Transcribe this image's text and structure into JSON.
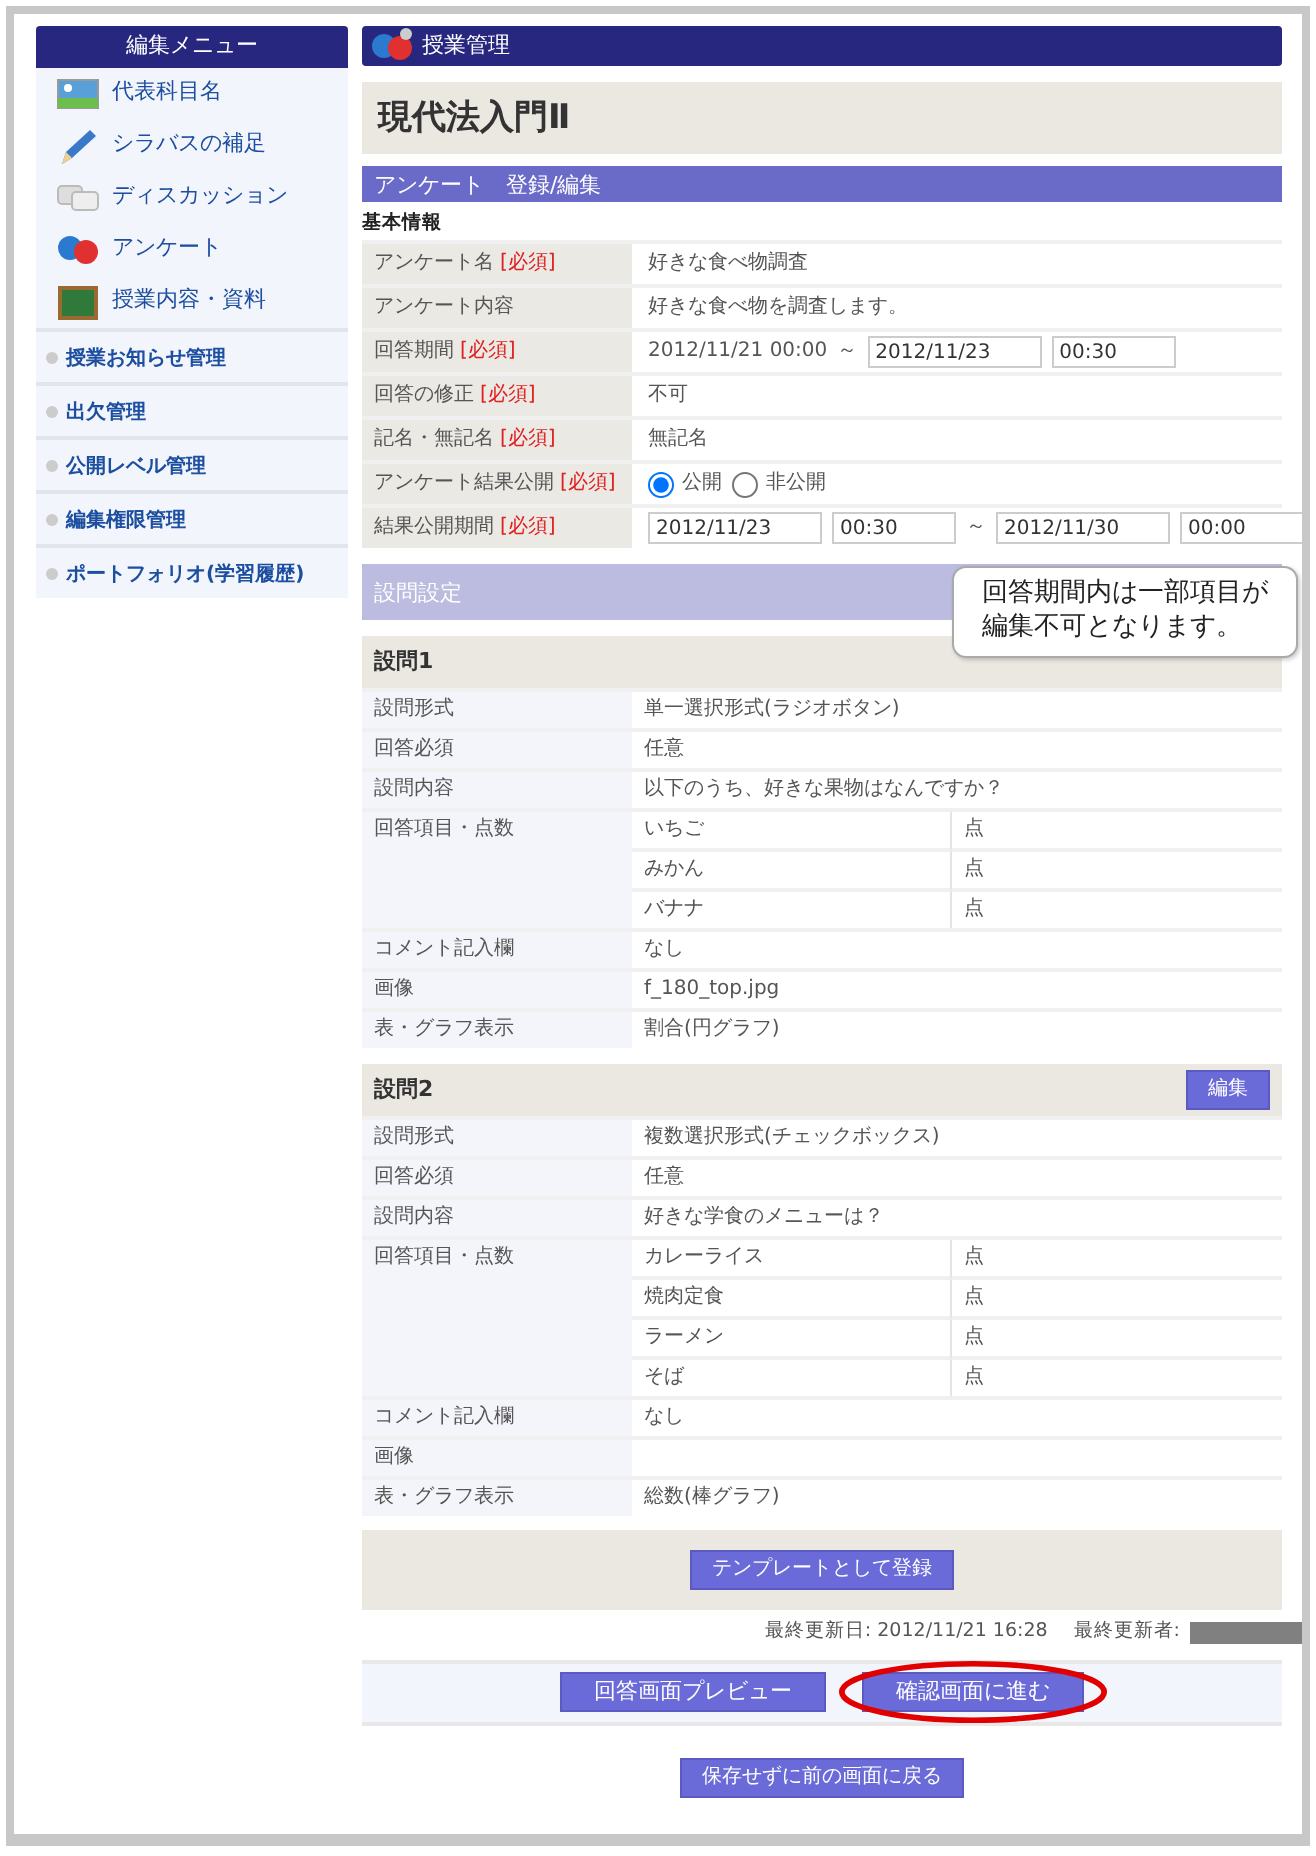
{
  "sidebar": {
    "title": "編集メニュー",
    "icon_items": [
      {
        "label": "代表科目名"
      },
      {
        "label": "シラバスの補足"
      },
      {
        "label": "ディスカッション"
      },
      {
        "label": "アンケート"
      },
      {
        "label": "授業内容・資料"
      }
    ],
    "link_items": [
      {
        "label": "授業お知らせ管理"
      },
      {
        "label": "出欠管理"
      },
      {
        "label": "公開レベル管理"
      },
      {
        "label": "編集権限管理"
      },
      {
        "label": "ポートフォリオ(学習履歴)"
      }
    ]
  },
  "header": {
    "title": "授業管理"
  },
  "course_title": "現代法入門Ⅱ",
  "section_title": "アンケート　登録/編集",
  "basic_info": {
    "heading": "基本情報",
    "rows": [
      {
        "label": "アンケート名",
        "required": "[必須]",
        "parts": [
          {
            "kind": "text",
            "text": "好きな食べ物調査"
          }
        ]
      },
      {
        "label": "アンケート内容",
        "parts": [
          {
            "kind": "text",
            "text": "好きな食べ物を調査します。"
          }
        ]
      },
      {
        "label": "回答期間",
        "required": "[必須]",
        "parts": [
          {
            "kind": "text",
            "text": "2012/11/21 00:00"
          },
          {
            "kind": "text",
            "text": "～"
          },
          {
            "kind": "input",
            "value": "2012/11/23"
          },
          {
            "kind": "input",
            "value": "00:30"
          }
        ]
      },
      {
        "label": "回答の修正",
        "required": "[必須]",
        "parts": [
          {
            "kind": "text",
            "text": "不可"
          }
        ]
      },
      {
        "label": "記名・無記名",
        "required": "[必須]",
        "parts": [
          {
            "kind": "text",
            "text": "無記名"
          }
        ]
      },
      {
        "label": "アンケート結果公開",
        "required": "[必須]",
        "parts": [
          {
            "kind": "radio",
            "label": "公開",
            "selected": true
          },
          {
            "kind": "radio",
            "label": "非公開",
            "selected": false
          }
        ]
      },
      {
        "label": "結果公開期間",
        "required": "[必須]",
        "parts": [
          {
            "kind": "input",
            "value": "2012/11/23"
          },
          {
            "kind": "input",
            "value": "00:30"
          },
          {
            "kind": "text",
            "text": "～"
          },
          {
            "kind": "input",
            "value": "2012/11/30"
          },
          {
            "kind": "input",
            "value": "00:00"
          }
        ]
      }
    ]
  },
  "question_settings": {
    "heading": "設問設定",
    "tooltip_lines": [
      "回答期間内は一部項目が",
      "編集不可となります。"
    ]
  },
  "questions": [
    {
      "title": "設問1",
      "rows": [
        {
          "label": "設問形式",
          "value": "単一選択形式(ラジオボタン)"
        },
        {
          "label": "回答必須",
          "value": "任意"
        },
        {
          "label": "設問内容",
          "value": "以下のうち、好きな果物はなんですか？"
        },
        {
          "label": "回答項目・点数",
          "choices": [
            {
              "text": "いちご",
              "unit": "点"
            },
            {
              "text": "みかん",
              "unit": "点"
            },
            {
              "text": "バナナ",
              "unit": "点"
            }
          ]
        },
        {
          "label": "コメント記入欄",
          "value": "なし"
        },
        {
          "label": "画像",
          "value": "f_180_top.jpg"
        },
        {
          "label": "表・グラフ表示",
          "value": "割合(円グラフ)"
        }
      ]
    },
    {
      "title": "設問2",
      "edit_button": "編集",
      "rows": [
        {
          "label": "設問形式",
          "value": "複数選択形式(チェックボックス)"
        },
        {
          "label": "回答必須",
          "value": "任意"
        },
        {
          "label": "設問内容",
          "value": "好きな学食のメニューは？"
        },
        {
          "label": "回答項目・点数",
          "choices": [
            {
              "text": "カレーライス",
              "unit": "点"
            },
            {
              "text": "焼肉定食",
              "unit": "点"
            },
            {
              "text": "ラーメン",
              "unit": "点"
            },
            {
              "text": "そば",
              "unit": "点"
            }
          ]
        },
        {
          "label": "コメント記入欄",
          "value": "なし"
        },
        {
          "label": "画像"
        },
        {
          "label": "表・グラフ表示",
          "value": "総数(棒グラフ)"
        }
      ]
    }
  ],
  "template_button": "テンプレートとして登録",
  "last_updated": {
    "date_label": "最終更新日:",
    "date": "2012/11/21 16:28",
    "user_label": "最終更新者:"
  },
  "action_buttons": [
    {
      "label": "回答画面プレビュー",
      "circled": false
    },
    {
      "label": "確認画面に進む",
      "circled": true
    }
  ],
  "back_button": "保存せずに前の画面に戻る"
}
